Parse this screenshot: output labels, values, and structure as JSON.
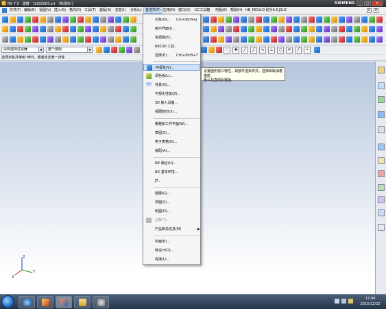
{
  "window": {
    "title": "NX 7.5 - 建模 - [1282003.prt （修改的）]",
    "brand": "SIEMENS",
    "controls": [
      "_",
      "□",
      "×"
    ]
  },
  "menubar": {
    "items": [
      "文件(F)",
      "编辑(E)",
      "视图(V)",
      "插入(S)",
      "格式(R)",
      "工具(T)",
      "装配(A)",
      "信息(I)",
      "分析(L)",
      "首选项(P)",
      "应用(N)",
      "窗口(O)",
      "GC工具箱",
      "电极(E)",
      "帮助(H)",
      "HB_MOULD 助手6.6",
      "JSUC"
    ],
    "active_index": 9
  },
  "filterbar": {
    "type_filter": "没有选择过滤器",
    "scope": "整个装配"
  },
  "cue_line": "选择对象并使用 MB3，或者双击某一对象",
  "preferences_menu": {
    "items": [
      {
        "label": "对象(O)...",
        "shortcut": "Ctrl+Shift+J",
        "disabled": false,
        "icon": ""
      },
      {
        "label": "用户界面(I)...",
        "shortcut": "",
        "disabled": false,
        "icon": ""
      },
      {
        "label": "资源板(E)...",
        "shortcut": "",
        "disabled": false,
        "icon": ""
      },
      {
        "label": "NX100 工具...",
        "shortcut": "",
        "disabled": false,
        "icon": ""
      },
      {
        "label": "选择(E)...",
        "shortcut": "Ctrl+Shift+T",
        "disabled": false,
        "icon": ""
      },
      {
        "label": "可视化(V)...",
        "shortcut": "",
        "disabled": false,
        "icon": "visualization-icon",
        "highlighted": true
      },
      {
        "label": "调色板(L)...",
        "shortcut": "",
        "disabled": false,
        "icon": "palette-icon"
      },
      {
        "label": "背景(G)...",
        "shortcut": "",
        "disabled": false,
        "icon": "background-icon"
      },
      {
        "label": "可视化性能(Z)...",
        "shortcut": "",
        "disabled": false,
        "icon": ""
      },
      {
        "label": "3D 输入设备...",
        "shortcut": "",
        "disabled": false,
        "icon": ""
      },
      {
        "label": "视图剖切(X)...",
        "shortcut": "",
        "disabled": false,
        "icon": ""
      },
      {
        "label": "栅格和工作平面(W)...",
        "shortcut": "",
        "disabled": false,
        "icon": ""
      },
      {
        "label": "草图(S)...",
        "shortcut": "",
        "disabled": false,
        "icon": ""
      },
      {
        "label": "电子表格(H)...",
        "shortcut": "",
        "disabled": false,
        "icon": ""
      },
      {
        "label": "装配(A)...",
        "shortcut": "",
        "disabled": false,
        "icon": ""
      },
      {
        "label": "NX 融合(U)...",
        "shortcut": "",
        "disabled": false,
        "icon": ""
      },
      {
        "label": "NX 基本环境...",
        "shortcut": "",
        "disabled": false,
        "icon": ""
      },
      {
        "label": "JT...",
        "shortcut": "",
        "disabled": false,
        "icon": ""
      },
      {
        "label": "建模(G)...",
        "shortcut": "",
        "disabled": false,
        "icon": ""
      },
      {
        "label": "草图(S)...",
        "shortcut": "",
        "disabled": false,
        "icon": ""
      },
      {
        "label": "制图(D)...",
        "shortcut": "",
        "disabled": false,
        "icon": ""
      },
      {
        "label": "注释(T)...",
        "shortcut": "",
        "disabled": true,
        "icon": "annotation-icon"
      },
      {
        "label": "产品制造信息(M)",
        "shortcut": "",
        "disabled": false,
        "icon": "",
        "submenu": true
      },
      {
        "label": "中面(E)...",
        "shortcut": "",
        "disabled": false,
        "icon": ""
      },
      {
        "label": "体设计(D)...",
        "shortcut": "",
        "disabled": false,
        "icon": ""
      },
      {
        "label": "焊接(L)...",
        "shortcut": "",
        "disabled": false,
        "icon": ""
      }
    ]
  },
  "tooltip": {
    "lines": [
      "设置图形窗口特性，如部件渲染样式，选择和取消着重颜",
      "色以及直线反锯齿。"
    ]
  },
  "viewport": {
    "triad_labels": [
      "Z",
      "Y",
      "X"
    ]
  },
  "taskbar": {
    "time": "17:04",
    "date": "2015/12/22"
  },
  "colors": {
    "menu_highlight": "#cfe1f7",
    "viewport_top": "#b6c6dd",
    "viewport_bottom": "#ffffff"
  }
}
